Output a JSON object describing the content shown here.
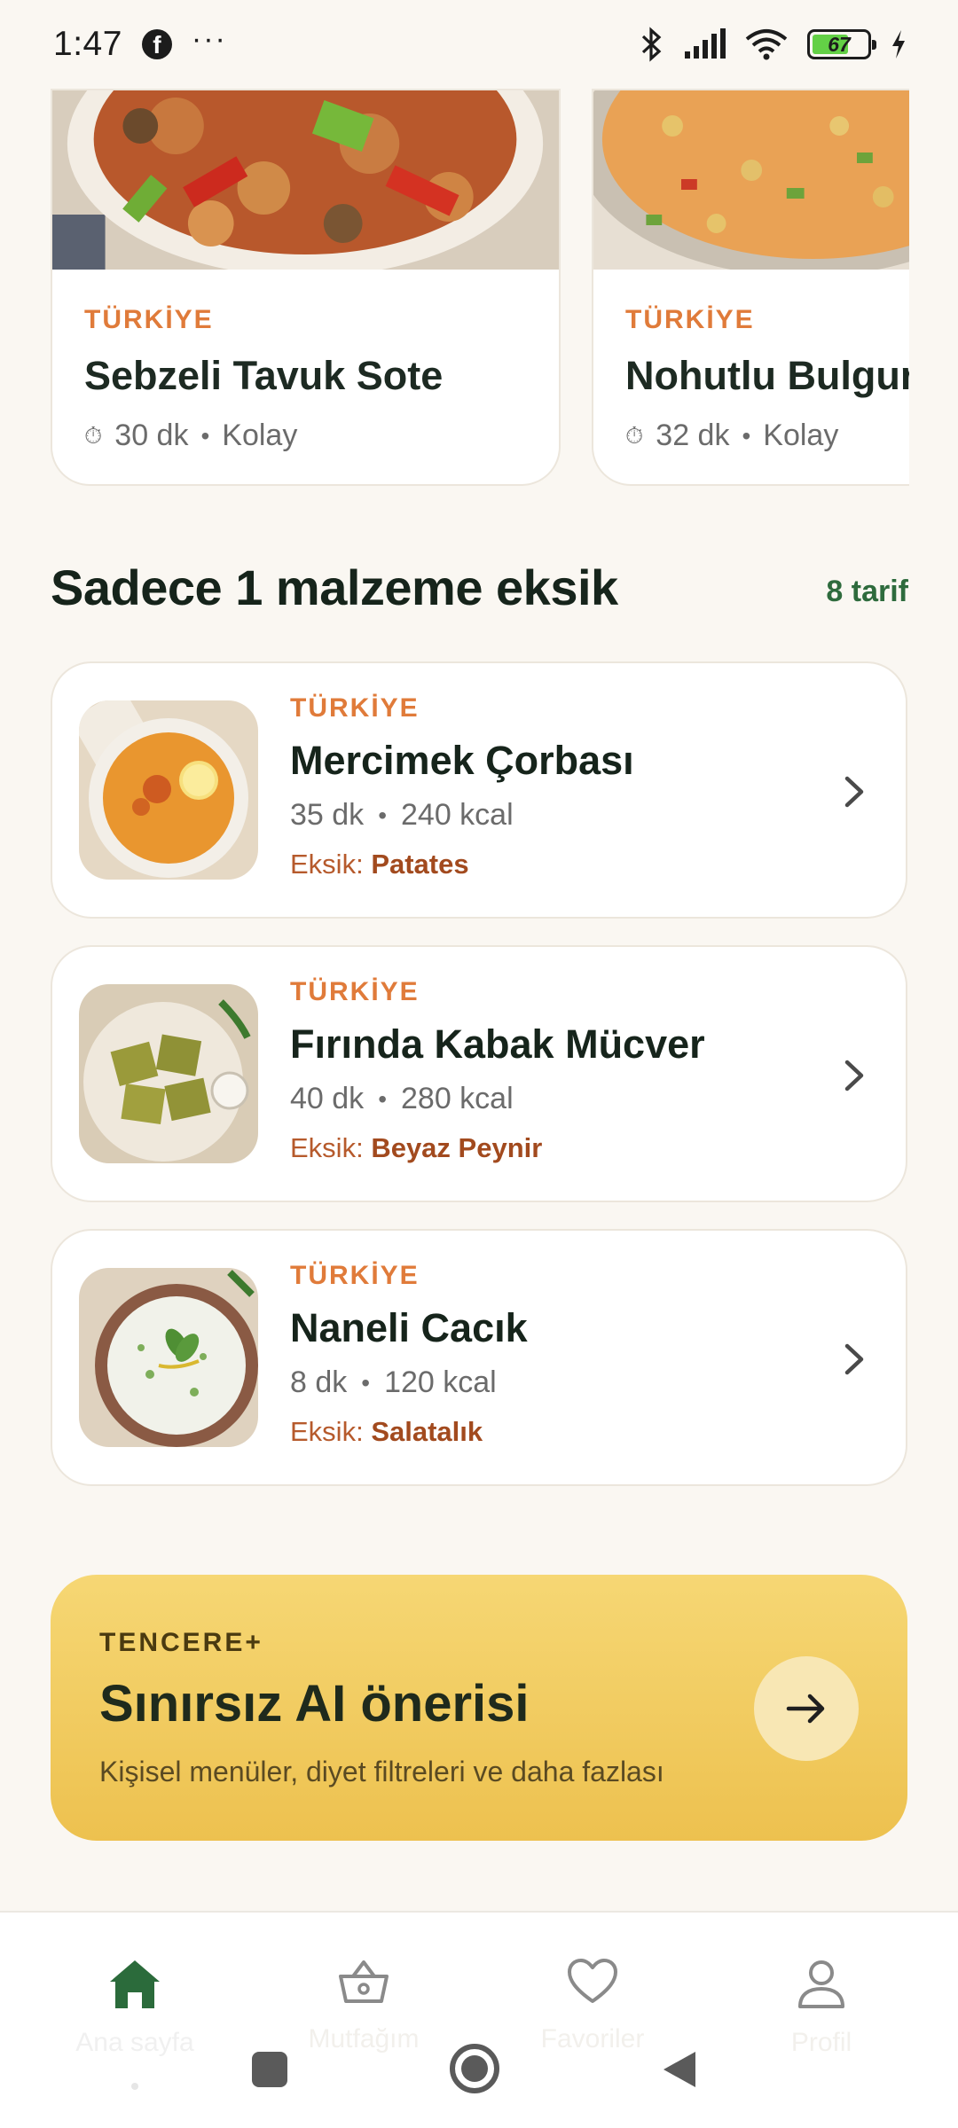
{
  "status_bar": {
    "time": "1:47",
    "battery": "67",
    "icons": [
      "facebook-icon",
      "more-icon",
      "bluetooth-icon",
      "signal-icon",
      "wifi-icon",
      "battery-icon",
      "charging-icon"
    ]
  },
  "featured": [
    {
      "country": "TÜRKİYE",
      "title": "Sebzeli Tavuk Sote",
      "time": "30 dk",
      "difficulty": "Kolay"
    },
    {
      "country": "TÜRKİYE",
      "title": "Nohutlu Bulgur",
      "time": "32 dk",
      "difficulty": "Kolay"
    }
  ],
  "missing_section": {
    "title": "Sadece 1 malzeme eksik",
    "count": "8 tarif",
    "missing_label": "Eksik:",
    "items": [
      {
        "country": "TÜRKİYE",
        "title": "Mercimek Çorbası",
        "time": "35 dk",
        "kcal": "240 kcal",
        "missing": "Patates"
      },
      {
        "country": "TÜRKİYE",
        "title": "Fırında Kabak Mücver",
        "time": "40 dk",
        "kcal": "280 kcal",
        "missing": "Beyaz Peynir"
      },
      {
        "country": "TÜRKİYE",
        "title": "Naneli Cacık",
        "time": "8 dk",
        "kcal": "120 kcal",
        "missing": "Salatalık"
      }
    ]
  },
  "promo": {
    "tag": "TENCERE+",
    "title": "Sınırsız AI önerisi",
    "subtitle": "Kişisel menüler, diyet filtreleri ve daha fazlası"
  },
  "nav": {
    "items": [
      {
        "label": "Ana sayfa",
        "icon": "home-icon",
        "active": true
      },
      {
        "label": "Mutfağım",
        "icon": "basket-icon",
        "active": false
      },
      {
        "label": "Favoriler",
        "icon": "heart-icon",
        "active": false
      },
      {
        "label": "Profil",
        "icon": "user-icon",
        "active": false
      }
    ]
  },
  "colors": {
    "background": "#faf7f2",
    "accent_orange": "#e07b3a",
    "accent_green": "#2e6b3d",
    "missing_text": "#a24a1e",
    "promo_gold": "#f0c85a"
  }
}
